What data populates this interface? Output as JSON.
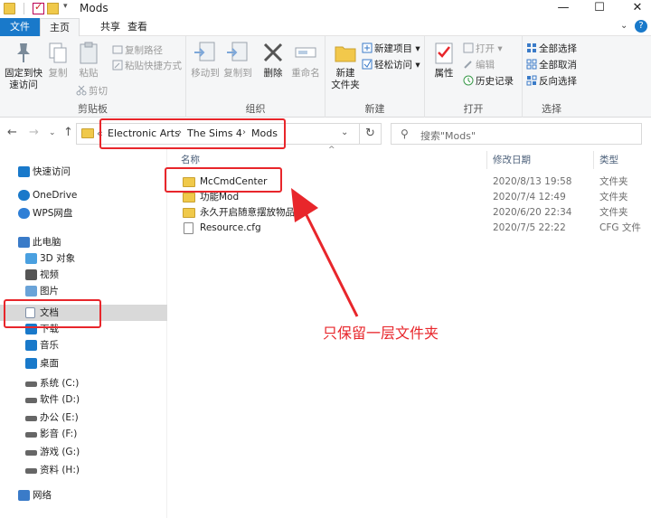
{
  "window": {
    "title": "Mods",
    "minimize_glyph": "—",
    "maximize_glyph": "☐",
    "close_glyph": "✕"
  },
  "tabs": {
    "file": "文件",
    "home": "主页",
    "share": "共享",
    "view": "查看"
  },
  "ribbon": {
    "clipboard": {
      "label": "剪贴板",
      "pin": "固定到快\n速访问",
      "copy": "复制",
      "paste": "粘贴",
      "copy_path": "复制路径",
      "paste_shortcut": "粘贴快捷方式",
      "cut": "剪切"
    },
    "organize": {
      "label": "组织",
      "move_to": "移动到",
      "copy_to": "复制到",
      "delete": "删除",
      "rename": "重命名"
    },
    "new": {
      "label": "新建",
      "new_folder": "新建\n文件夹",
      "new_item": "新建项目 ▾",
      "easy_access": "轻松访问 ▾"
    },
    "open": {
      "label": "打开",
      "properties": "属性",
      "open": "打开 ▾",
      "edit": "编辑",
      "history": "历史记录"
    },
    "select": {
      "label": "选择",
      "select_all": "全部选择",
      "select_none": "全部取消",
      "invert": "反向选择"
    }
  },
  "address": {
    "breadcrumbs": [
      "Electronic Arts",
      "The Sims 4",
      "Mods"
    ],
    "overflow": "«",
    "search_placeholder": "搜索\"Mods\""
  },
  "nav": [
    {
      "label": "快速访问",
      "icon": "star-icon",
      "color": "#1979ca"
    },
    {
      "label": "OneDrive",
      "icon": "cloud-icon",
      "color": "#1979ca"
    },
    {
      "label": "WPS网盘",
      "icon": "cloud-icon",
      "color": "#2f7fd6"
    },
    {
      "label": "此电脑",
      "icon": "computer-icon",
      "color": "#3a7bc8"
    },
    {
      "label": "3D 对象",
      "icon": "cube-icon",
      "color": "#4aa0e0"
    },
    {
      "label": "视频",
      "icon": "video-icon",
      "color": "#555555"
    },
    {
      "label": "图片",
      "icon": "image-icon",
      "color": "#6aa3d8"
    },
    {
      "label": "文档",
      "icon": "document-icon",
      "color": "#7f8fa6"
    },
    {
      "label": "下载",
      "icon": "download-icon",
      "color": "#1979ca"
    },
    {
      "label": "音乐",
      "icon": "music-icon",
      "color": "#1979ca"
    },
    {
      "label": "桌面",
      "icon": "desktop-icon",
      "color": "#1979ca"
    },
    {
      "label": "系统 (C:)",
      "icon": "drive-icon",
      "color": "#666666"
    },
    {
      "label": "软件 (D:)",
      "icon": "drive-icon",
      "color": "#666666"
    },
    {
      "label": "办公 (E:)",
      "icon": "drive-icon",
      "color": "#666666"
    },
    {
      "label": "影音 (F:)",
      "icon": "drive-icon",
      "color": "#666666"
    },
    {
      "label": "游戏 (G:)",
      "icon": "drive-icon",
      "color": "#666666"
    },
    {
      "label": "资料 (H:)",
      "icon": "drive-icon",
      "color": "#666666"
    },
    {
      "label": "网络",
      "icon": "network-icon",
      "color": "#3a7bc8"
    }
  ],
  "columns": {
    "name": "名称",
    "date": "修改日期",
    "type": "类型"
  },
  "files": [
    {
      "name": "McCmdCenter",
      "date": "2020/8/13 19:58",
      "type": "文件夹",
      "kind": "folder"
    },
    {
      "name": "功能Mod",
      "date": "2020/7/4 12:49",
      "type": "文件夹",
      "kind": "folder"
    },
    {
      "name": "永久开启随意摆放物品",
      "date": "2020/6/20 22:34",
      "type": "文件夹",
      "kind": "folder"
    },
    {
      "name": "Resource.cfg",
      "date": "2020/7/5 22:22",
      "type": "CFG 文件",
      "kind": "file"
    }
  ],
  "annotation": {
    "text": "只保留一层文件夹",
    "color": "#e8262b"
  }
}
